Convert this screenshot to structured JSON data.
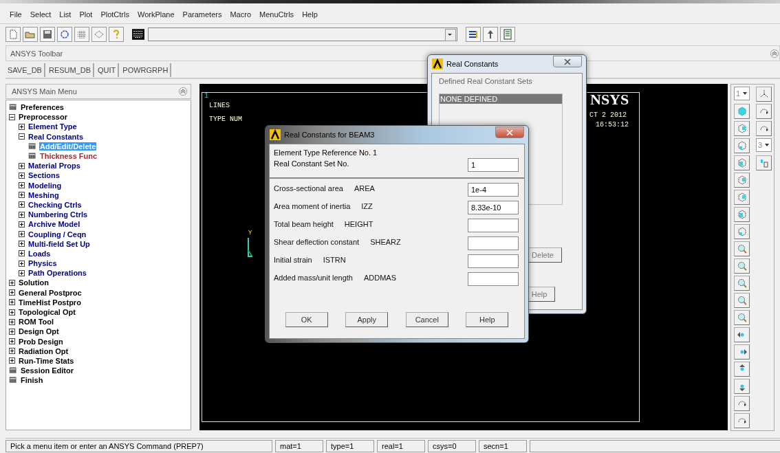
{
  "menu_bar": [
    "File",
    "Select",
    "List",
    "Plot",
    "PlotCtrls",
    "WorkPlane",
    "Parameters",
    "Macro",
    "MenuCtrls",
    "Help"
  ],
  "toolbar": {
    "title": "ANSYS Toolbar",
    "buttons": [
      "SAVE_DB",
      "RESUM_DB",
      "QUIT",
      "POWRGRPH"
    ]
  },
  "main_menu": {
    "title": "ANSYS Main Menu",
    "items": [
      {
        "label": "Preferences",
        "kind": "page",
        "selected": false
      },
      {
        "label": "Preprocessor",
        "kind": "folder",
        "expanded": true,
        "selected": false,
        "children": [
          {
            "label": "Element Type",
            "kind": "folder",
            "expanded": false,
            "selected": false
          },
          {
            "label": "Real Constants",
            "kind": "folder",
            "expanded": true,
            "selected": false,
            "children": [
              {
                "label": "Add/Edit/Delete",
                "kind": "page",
                "selected": true
              },
              {
                "label": "Thickness Func",
                "kind": "page",
                "selected": false,
                "color": "#a52a2a"
              }
            ]
          },
          {
            "label": "Material Props",
            "kind": "folder",
            "expanded": false,
            "selected": false
          },
          {
            "label": "Sections",
            "kind": "folder",
            "expanded": false,
            "selected": false
          },
          {
            "label": "Modeling",
            "kind": "folder",
            "expanded": false,
            "selected": false
          },
          {
            "label": "Meshing",
            "kind": "folder",
            "expanded": false,
            "selected": false
          },
          {
            "label": "Checking Ctrls",
            "kind": "folder",
            "expanded": false,
            "selected": false
          },
          {
            "label": "Numbering Ctrls",
            "kind": "folder",
            "expanded": false,
            "selected": false
          },
          {
            "label": "Archive Model",
            "kind": "folder",
            "expanded": false,
            "selected": false
          },
          {
            "label": "Coupling / Ceqn",
            "kind": "folder",
            "expanded": false,
            "selected": false
          },
          {
            "label": "Multi-field Set Up",
            "kind": "folder",
            "expanded": false,
            "selected": false
          },
          {
            "label": "Loads",
            "kind": "folder",
            "expanded": false,
            "selected": false
          },
          {
            "label": "Physics",
            "kind": "folder",
            "expanded": false,
            "selected": false
          },
          {
            "label": "Path Operations",
            "kind": "folder",
            "expanded": false,
            "selected": false
          }
        ]
      },
      {
        "label": "Solution",
        "kind": "folder",
        "expanded": false,
        "selected": false
      },
      {
        "label": "General Postproc",
        "kind": "folder",
        "expanded": false,
        "selected": false
      },
      {
        "label": "TimeHist Postpro",
        "kind": "folder",
        "expanded": false,
        "selected": false
      },
      {
        "label": "Topological Opt",
        "kind": "folder",
        "expanded": false,
        "selected": false
      },
      {
        "label": "ROM Tool",
        "kind": "folder",
        "expanded": false,
        "selected": false
      },
      {
        "label": "Design Opt",
        "kind": "folder",
        "expanded": false,
        "selected": false
      },
      {
        "label": "Prob Design",
        "kind": "folder",
        "expanded": false,
        "selected": false
      },
      {
        "label": "Radiation Opt",
        "kind": "folder",
        "expanded": false,
        "selected": false
      },
      {
        "label": "Run-Time Stats",
        "kind": "folder",
        "expanded": false,
        "selected": false
      },
      {
        "label": "Session Editor",
        "kind": "page",
        "selected": false
      },
      {
        "label": "Finish",
        "kind": "page",
        "selected": false
      }
    ]
  },
  "graphics": {
    "window_number": "1",
    "lines": [
      "LINES",
      "TYPE NUM"
    ],
    "logo": "NSYS",
    "date": "CT  2 2012",
    "time": "16:53:12",
    "axis_label": "Y"
  },
  "view_selectors": [
    "1",
    "3"
  ],
  "real_constants_dialog": {
    "title": "Real Constants",
    "list_label": "Defined Real Constant Sets",
    "sets": [
      {
        "label": "NONE DEFINED",
        "selected": true
      }
    ],
    "buttons": [
      "Delete",
      "Help"
    ]
  },
  "beam_dialog": {
    "title": "Real Constants for BEAM3",
    "reference": "Element Type Reference No. 1",
    "set_field": {
      "label": "Real Constant Set No.",
      "value": "1"
    },
    "fields": [
      {
        "label": "Cross-sectional area",
        "symbol": "AREA",
        "value": "1e-4"
      },
      {
        "label": "Area moment of inertia",
        "symbol": "IZZ",
        "value": "8.33e-10"
      },
      {
        "label": "Total beam height",
        "symbol": "HEIGHT"
      },
      {
        "label": "Shear deflection constant",
        "symbol": "SHEARZ"
      },
      {
        "label": "Initial strain",
        "symbol": "ISTRN"
      },
      {
        "label": "Added mass/unit length",
        "symbol": "ADDMAS"
      }
    ],
    "buttons": [
      "OK",
      "Apply",
      "Cancel",
      "Help"
    ]
  },
  "status_bar": {
    "prompt": "Pick a menu item or enter an ANSYS Command (PREP7)",
    "fields": [
      "mat=1",
      "type=1",
      "real=1",
      "csys=0",
      "secn=1"
    ]
  }
}
